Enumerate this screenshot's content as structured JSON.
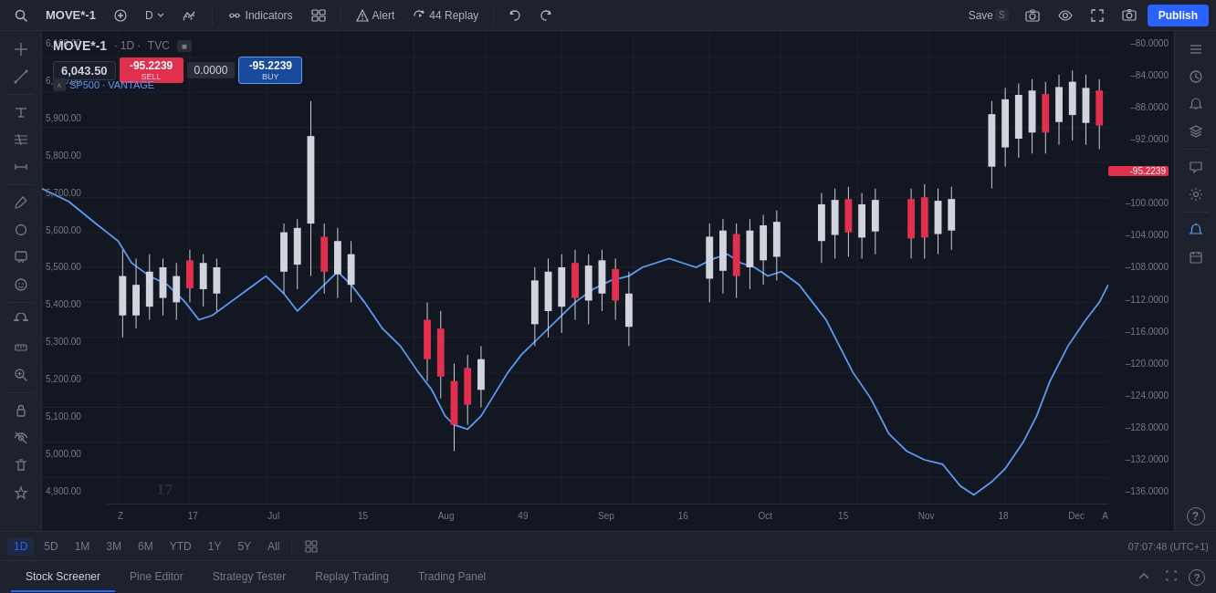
{
  "header": {
    "symbol": "MOVE*-1",
    "add_label": "+",
    "timeframe": "D",
    "compare_icon": "compare",
    "indicators_label": "Indicators",
    "layouts_label": "layouts",
    "alert_label": "Alert",
    "replay_label": "Replay",
    "undo_label": "undo",
    "redo_label": "redo",
    "save_label": "Save",
    "save_shortcut": "S",
    "camera_label": "camera",
    "watchlist_label": "watchlist",
    "fullscreen_label": "fullscreen",
    "screenshot_label": "screenshot",
    "publish_label": "Publish"
  },
  "chart": {
    "symbol_full": "MOVE*-1",
    "timeframe": "1D",
    "source": "TVC",
    "overlay_name": "SP500 · VANTAGE",
    "current_price": "6,043.50",
    "sell_price": "-95.2239",
    "buy_price": "-95.2239",
    "neutral_price": "0.0000",
    "right_price_label": "-95.2239",
    "price_levels_left": [
      "6,100.00",
      "6,000.00",
      "5,900.00",
      "5,800.00",
      "5,700.00",
      "5,600.00",
      "5,500.00",
      "5,400.00",
      "5,300.00",
      "5,200.00",
      "5,100.00",
      "5,000.00",
      "4,900.00"
    ],
    "price_levels_right": [
      "-80.0000",
      "-84.0000",
      "-88.0000",
      "-92.0000",
      "-96.0000",
      "-100.0000",
      "-104.0000",
      "-108.0000",
      "-112.0000",
      "-116.0000",
      "-120.0000",
      "-124.0000",
      "-128.0000",
      "-132.0000",
      "-136.0000"
    ],
    "x_labels": [
      "Z",
      "17",
      "Jul",
      "15",
      "Aug",
      "49",
      "Sep",
      "16",
      "Oct",
      "15",
      "Nov",
      "18",
      "Dec",
      "A"
    ]
  },
  "timeframes": {
    "buttons": [
      "1D",
      "5D",
      "1M",
      "3M",
      "6M",
      "YTD",
      "1Y",
      "5Y",
      "All"
    ],
    "active": "1D",
    "layout_icon": "layout",
    "time_display": "07:07:48 (UTC+1)"
  },
  "bottom_panel": {
    "tabs": [
      "Stock Screener",
      "Pine Editor",
      "Strategy Tester",
      "Replay Trading",
      "Trading Panel"
    ],
    "active_tab": "Stock Screener",
    "collapse_icon": "chevron-up",
    "expand_icon": "expand",
    "help_icon": "help"
  },
  "left_tools": [
    {
      "name": "crosshair",
      "icon": "✛"
    },
    {
      "name": "draw-line",
      "icon": "╱"
    },
    {
      "name": "text",
      "icon": "A"
    },
    {
      "name": "patterns",
      "icon": "⊞"
    },
    {
      "name": "measure",
      "icon": "↔"
    },
    {
      "name": "fibonnaci",
      "icon": "𝑓"
    },
    {
      "name": "brush",
      "icon": "✏"
    },
    {
      "name": "shapes",
      "icon": "○"
    },
    {
      "name": "annotation",
      "icon": "T"
    },
    {
      "name": "emoji",
      "icon": "☺"
    },
    {
      "name": "magnet",
      "icon": "⌖"
    },
    {
      "name": "ruler",
      "icon": "📐"
    },
    {
      "name": "zoom",
      "icon": "🔍"
    },
    {
      "name": "lock",
      "icon": "🔒"
    },
    {
      "name": "eye",
      "icon": "👁"
    },
    {
      "name": "trash",
      "icon": "🗑"
    },
    {
      "name": "star",
      "icon": "★"
    }
  ],
  "right_tools": [
    {
      "name": "watch-list",
      "icon": "☰"
    },
    {
      "name": "clock",
      "icon": "⏱"
    },
    {
      "name": "alert-list",
      "icon": "🔔"
    },
    {
      "name": "layers",
      "icon": "⧉"
    },
    {
      "name": "chat",
      "icon": "💬"
    },
    {
      "name": "settings-side",
      "icon": "⚙"
    },
    {
      "name": "alert-bell",
      "icon": "🔔"
    },
    {
      "name": "calendar",
      "icon": "📅"
    },
    {
      "name": "question",
      "icon": "?"
    }
  ],
  "logo": "17"
}
